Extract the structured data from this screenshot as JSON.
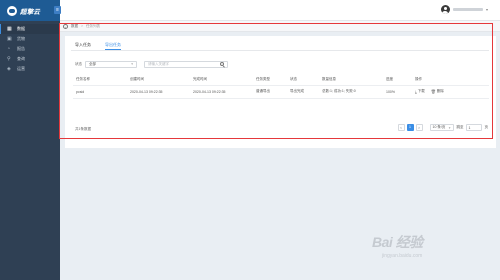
{
  "brand": {
    "name": "超擎云"
  },
  "user": {
    "name": ""
  },
  "sidebar": {
    "items": [
      {
        "label": "数据",
        "icon": "database-icon",
        "active": true
      },
      {
        "label": "货物",
        "icon": "box-icon",
        "active": false
      },
      {
        "label": "报告",
        "icon": "chart-icon",
        "active": false
      },
      {
        "label": "查询",
        "icon": "search-icon",
        "active": false
      },
      {
        "label": "运营",
        "icon": "shield-icon",
        "active": false
      }
    ]
  },
  "breadcrumb": {
    "root": "数据",
    "separator": ">",
    "current": "任务列表"
  },
  "tabs": [
    {
      "label": "导入任务",
      "active": false
    },
    {
      "label": "导出任务",
      "active": true
    }
  ],
  "filters": {
    "status_label": "状态",
    "status_value": "全部",
    "search_placeholder": "请输入关键字"
  },
  "table": {
    "columns": [
      "任务名称",
      "创建时间",
      "完成时间",
      "任务类型",
      "状态",
      "数量信息",
      "进度",
      "操作"
    ],
    "rows": [
      {
        "name": "pcsid",
        "created": "2020-04-13 09:22:35",
        "completed": "2020-04-13 09:22:35",
        "type": "普通导出",
        "status": "导出完成",
        "count_info": "总数:1; 成功:1; 失败:0",
        "progress": "100%",
        "actions": {
          "download": "下载",
          "delete": "删除"
        }
      }
    ]
  },
  "pagination": {
    "total_text": "共1条数据",
    "prev": "<",
    "current_page": "1",
    "next": ">",
    "page_size": "10 条/页",
    "goto_label": "跳至",
    "goto_value": "1",
    "page_suffix": "页"
  },
  "watermark": {
    "text": "Bai 经验",
    "subtext": "jingyan.baidu.com"
  },
  "colors": {
    "sidebar_bg": "#2f4054",
    "brand_bg": "#1e5b94",
    "accent": "#3a8ee6",
    "highlight_border": "#e5383b"
  }
}
